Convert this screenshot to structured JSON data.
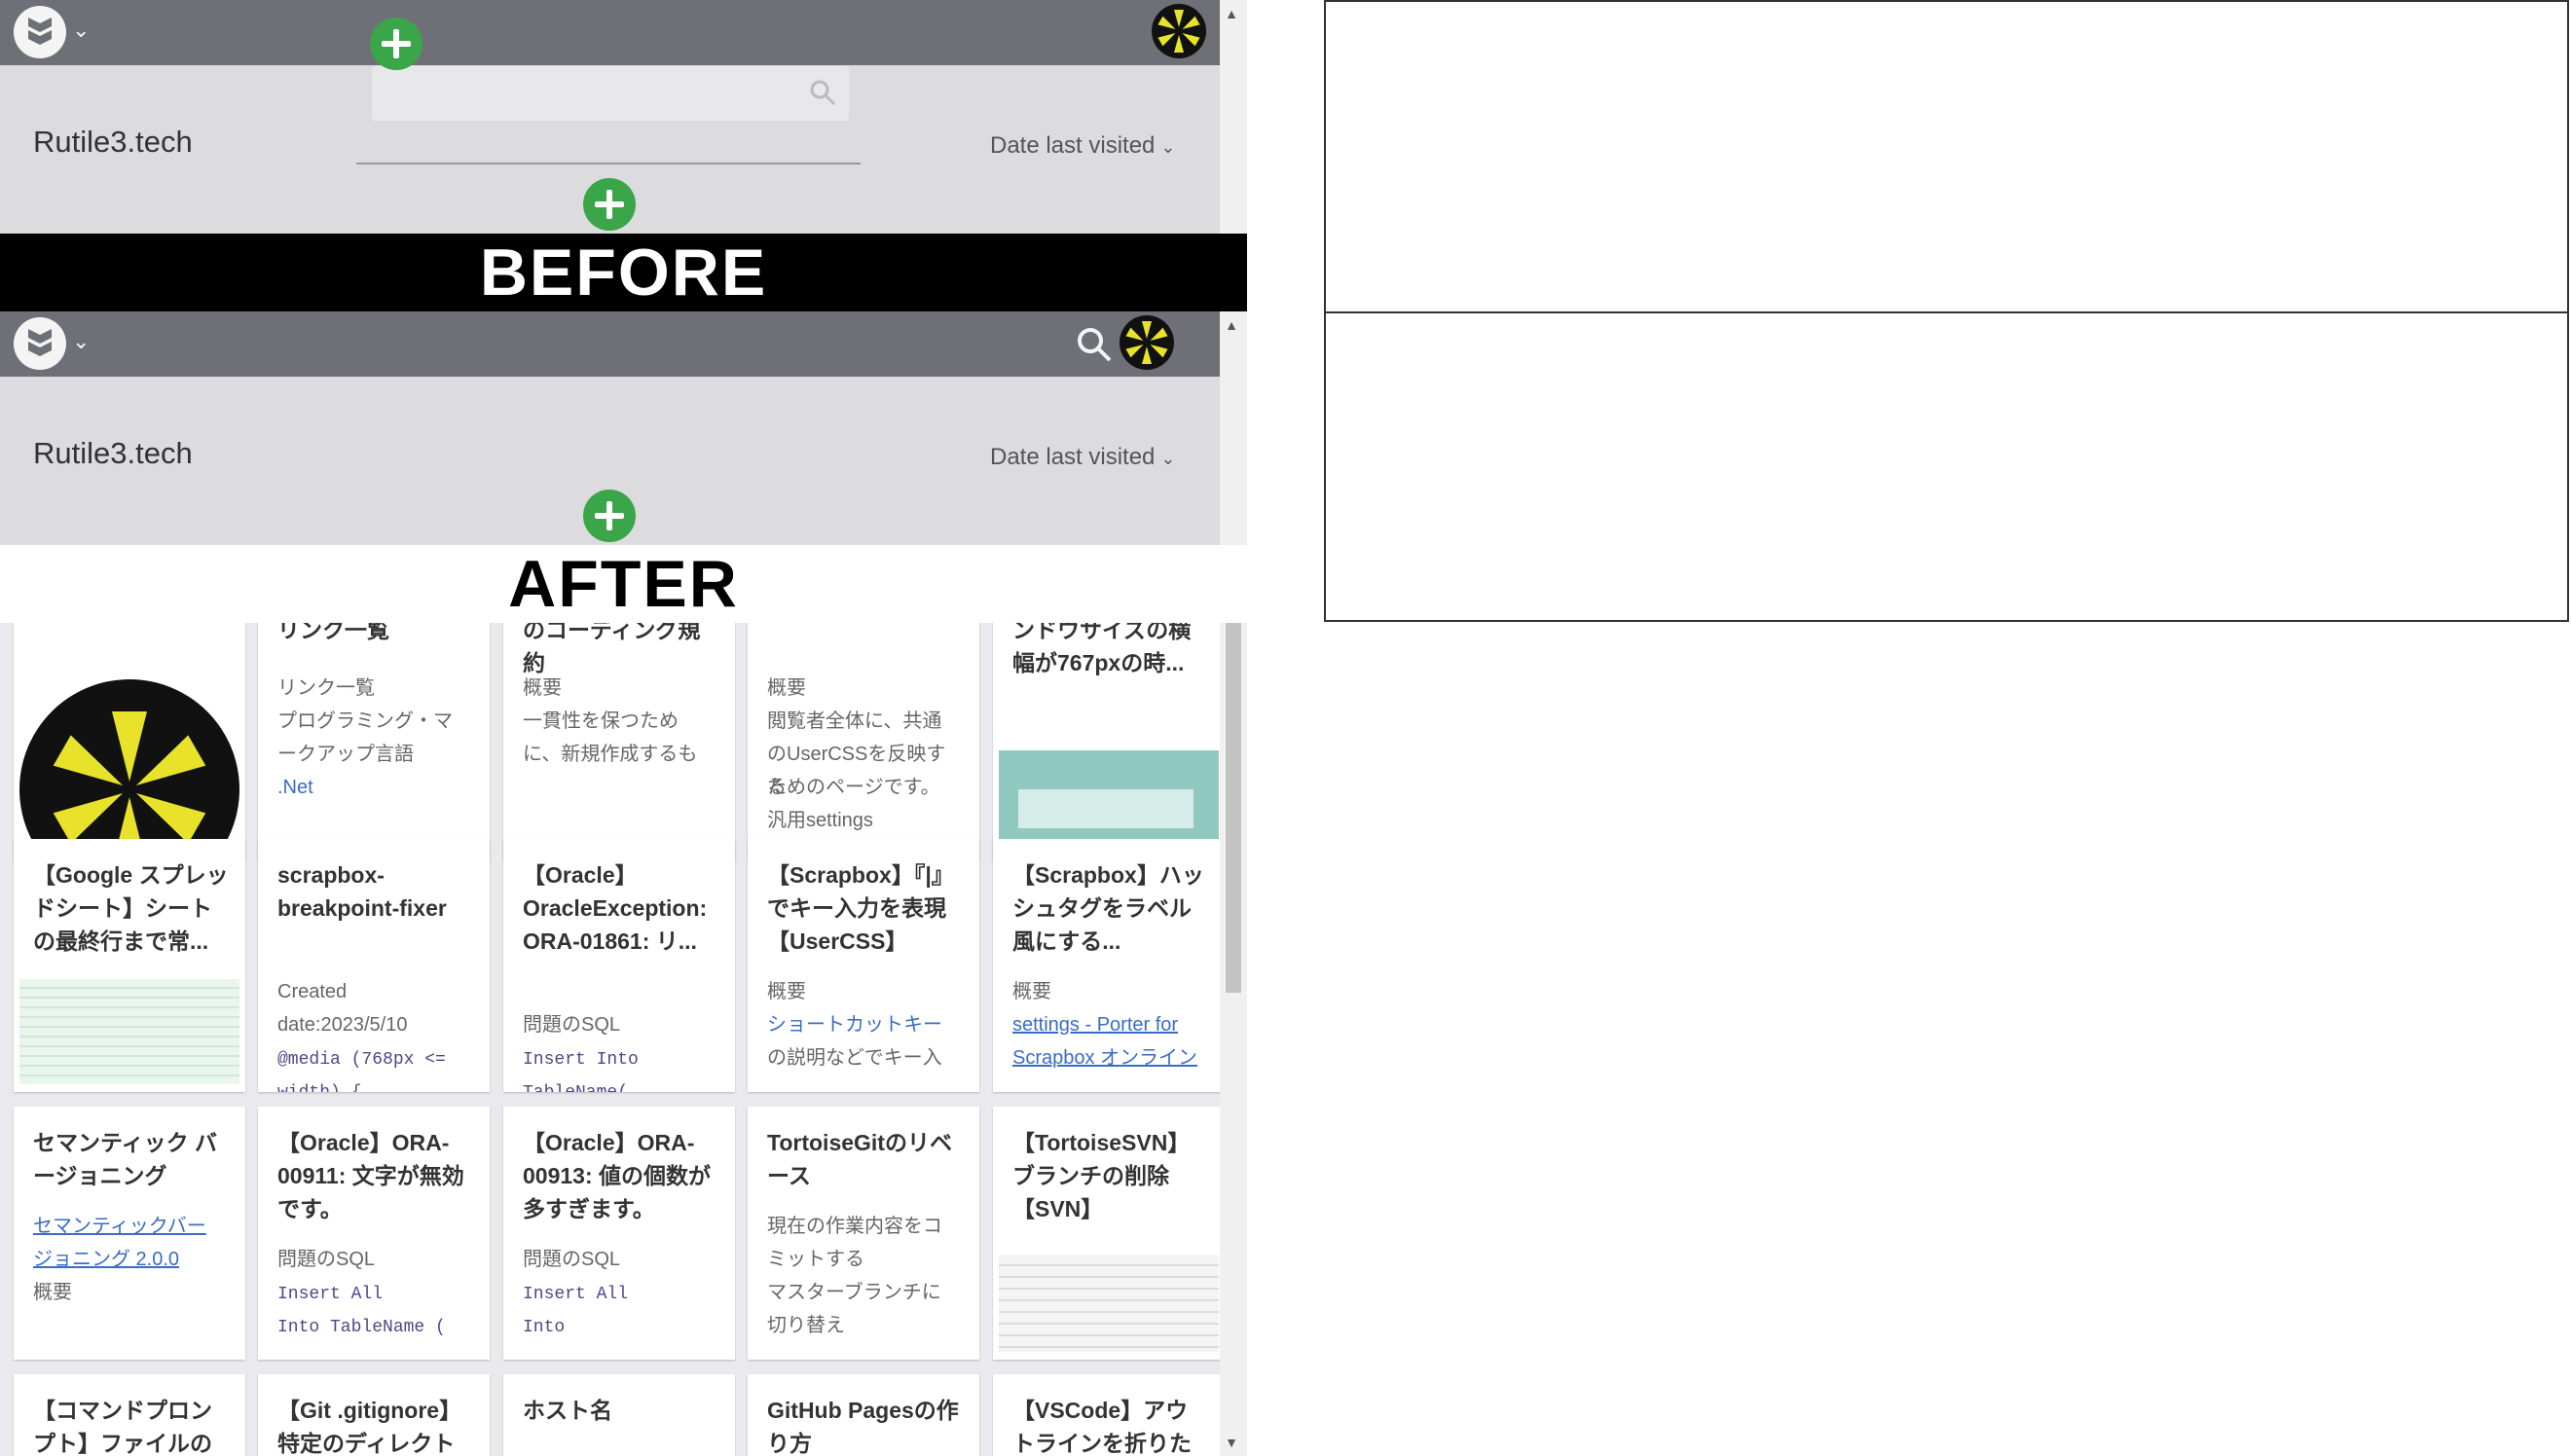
{
  "before": {
    "project_title": "Rutile3.tech",
    "sort_label": "Date last visited",
    "search_placeholder": "",
    "banner": "BEFORE"
  },
  "after": {
    "project_title": "Rutile3.tech",
    "sort_label": "Date last visited",
    "banner": "AFTER"
  },
  "cards_row0": [
    {
      "title": "",
      "body": []
    },
    {
      "title": "リンク一覧",
      "body": [
        "リンク一覧",
        "プログラミング・マ",
        "ークアップ言語",
        ".Net"
      ]
    },
    {
      "title": "のコーディング規約",
      "body": [
        "概要",
        "一貫性を保つため",
        "に、新規作成するも"
      ]
    },
    {
      "title": "",
      "body": [
        "概要",
        "閲覧者全体に、共通",
        "のUserCSSを反映する",
        "ためのページです。",
        "汎用settings"
      ]
    },
    {
      "title": "ンドウサイズの横幅が767pxの時...",
      "body": []
    }
  ],
  "cards_row1": [
    {
      "title": "【Google スプレッドシート】シートの最終行まで常...",
      "body": []
    },
    {
      "title": "scrapbox-breakpoint-fixer",
      "body": [
        "Created",
        "date:2023/5/10",
        "@media (768px <=",
        "width) {"
      ]
    },
    {
      "title": "【Oracle】OracleException: ORA-01861: リ...",
      "body": [
        "問題のSQL",
        "Insert Into",
        "TableName("
      ]
    },
    {
      "title": "【Scrapbox】『|』でキー入力を表現【UserCSS】",
      "body": [
        "概要",
        "ショートカットキー",
        "の説明などでキー入"
      ]
    },
    {
      "title": "【Scrapbox】ハッシュタグをラベル風にする...",
      "body": [
        "概要",
        "settings - Porter for",
        "Scrapbox オンライン"
      ]
    }
  ],
  "cards_row2": [
    {
      "title": "セマンティック バージョニング",
      "body": [
        "セマンティックバー",
        "ジョニング 2.0.0",
        "概要"
      ]
    },
    {
      "title": "【Oracle】ORA-00911: 文字が無効です。",
      "body": [
        "問題のSQL",
        "Insert All",
        "Into TableName ("
      ]
    },
    {
      "title": "【Oracle】ORA-00913: 値の個数が多すぎます。",
      "body": [
        "問題のSQL",
        "Insert All",
        "Into"
      ]
    },
    {
      "title": "TortoiseGitのリベース",
      "body": [
        "現在の作業内容をコ",
        "ミットする",
        "マスターブランチに",
        "切り替え"
      ]
    },
    {
      "title": "【TortoiseSVN】ブランチの削除【SVN】",
      "body": []
    }
  ],
  "cards_row3": [
    {
      "title": "【コマンドプロンプト】ファイルの",
      "body": []
    },
    {
      "title": "【Git .gitignore】特定のディレクト",
      "body": []
    },
    {
      "title": "ホスト名",
      "body": []
    },
    {
      "title": "GitHub Pagesの作り方",
      "body": []
    },
    {
      "title": "【VSCode】アウトラインを折りた",
      "body": []
    }
  ],
  "colors": {
    "topbar": "#6e6f77",
    "panel_bg": "#dcdcdf",
    "add_button": "#3ba54a",
    "link": "#3a6cc4"
  },
  "icons": [
    "scrapbox-logo-icon",
    "chevron-down-icon",
    "plus-icon",
    "search-icon",
    "user-avatar-icon"
  ]
}
